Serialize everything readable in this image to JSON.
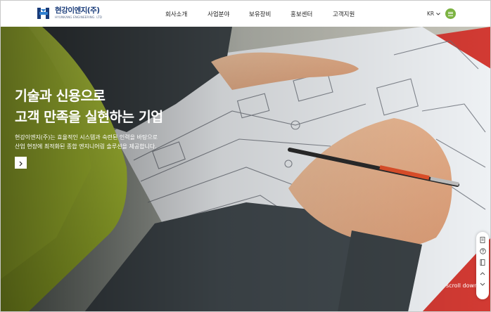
{
  "header": {
    "logo": {
      "name_ko": "현강이엔지(주)",
      "name_en": "HYUNKANG ENGINEERING. LTD"
    },
    "nav": [
      "회사소개",
      "사업분야",
      "보유장비",
      "홍보센터",
      "고객지원"
    ],
    "language": "KR",
    "menu_icon": "hamburger-icon"
  },
  "hero": {
    "title_line1": "기술과 신용으로",
    "title_line2": "고객 만족을 실현하는 기업",
    "desc_line1": "현강이엔지(주)는 효율적인 시스템과 숙련된 인력을 바탕으로",
    "desc_line2": "산업 현장에 최적화된 종합 엔지니어링 솔루션을 제공합니다.",
    "more_icon": "chevron-right-icon",
    "scroll_label": "scroll down",
    "image": "engineer-reviewing-blueprint-photo"
  },
  "quick_menu": {
    "icons": [
      "document-icon",
      "question-icon",
      "book-icon",
      "chevron-up-icon",
      "chevron-down-icon"
    ]
  },
  "colors": {
    "brand_blue": "#1a3c7a",
    "accent_green": "#7cb342",
    "safety_vest": "#d4ef3c",
    "text_dark": "#222222"
  }
}
